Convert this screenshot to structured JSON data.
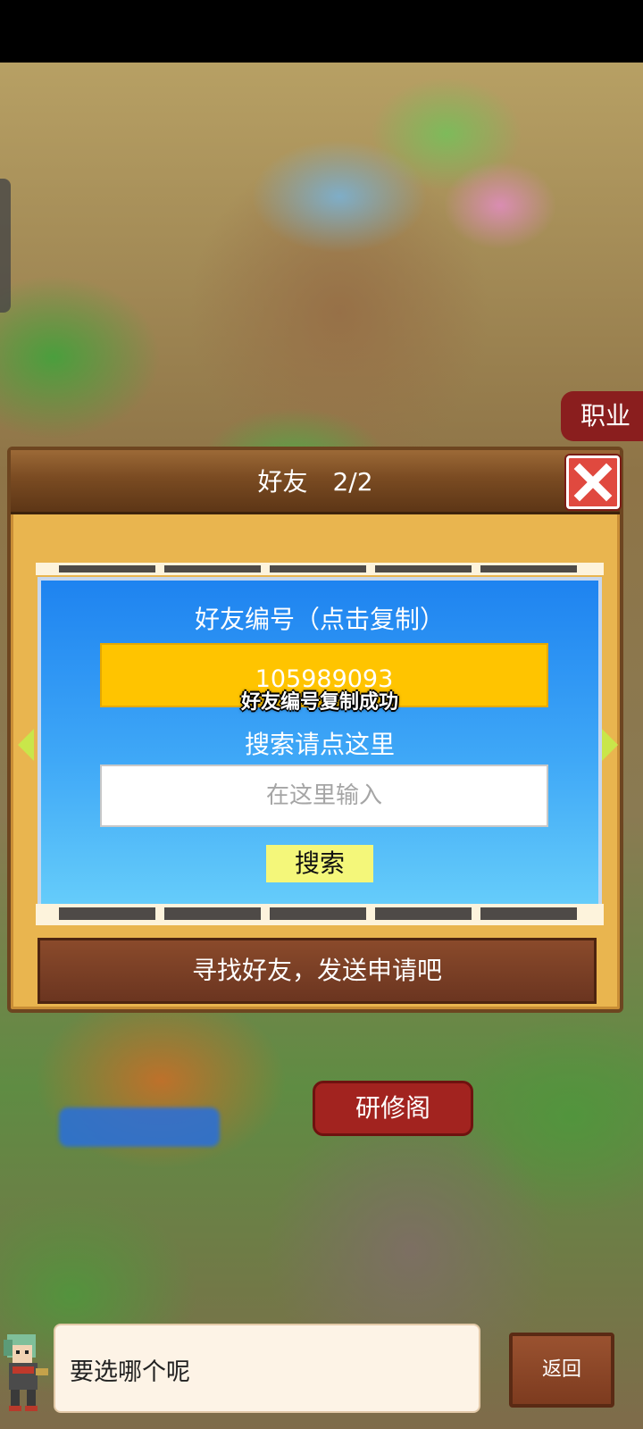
{
  "background": {
    "label_job": "职业",
    "label_training_hall": "研修阁"
  },
  "dialog": {
    "title": "好友　2/2",
    "friend_id_title": "好友编号（点击复制）",
    "friend_id_value": "105989093",
    "copy_toast": "好友编号复制成功",
    "search_hint": "搜索请点这里",
    "search_placeholder": "在这里输入",
    "search_button": "搜索",
    "find_banner": "寻找好友，发送申请吧"
  },
  "bottom": {
    "speech_text": "要选哪个呢",
    "back_button": "返回"
  },
  "colors": {
    "panel_blue": "#1e83f0",
    "id_box_yellow": "#ffc400",
    "close_red": "#e0493f",
    "frame_gold": "#e9b54f"
  },
  "icons": [
    "close-icon",
    "arrow-left-icon",
    "arrow-right-icon",
    "avatar"
  ]
}
